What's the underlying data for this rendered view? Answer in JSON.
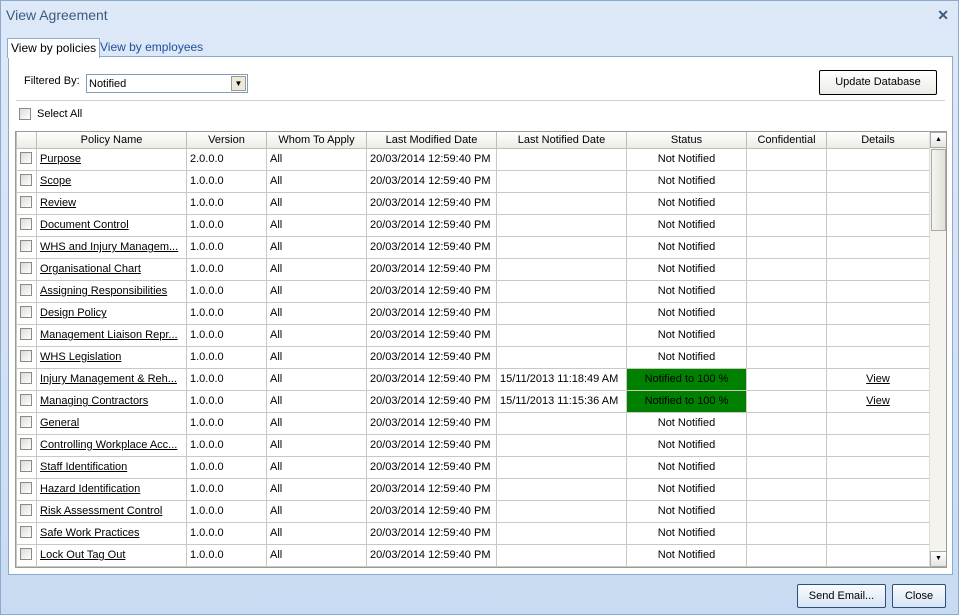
{
  "window": {
    "title": "View Agreement",
    "close_icon": "close-icon"
  },
  "tabs": [
    {
      "label": "View by policies",
      "active": true
    },
    {
      "label": "View by employees",
      "active": false
    }
  ],
  "filter": {
    "label": "Filtered By:",
    "value": "Notified"
  },
  "update_button": "Update Database",
  "select_all": "Select All",
  "columns": [
    "",
    "Policy Name",
    "Version",
    "Whom To Apply",
    "Last Modified Date",
    "Last Notified Date",
    "Status",
    "Confidential",
    "Details"
  ],
  "status_color": "#008000",
  "rows": [
    {
      "name": "Purpose",
      "version": "2.0.0.0",
      "whom": "All",
      "modified": "20/03/2014 12:59:40 PM",
      "notified": "",
      "status": "Not Notified",
      "confidential": "",
      "details": ""
    },
    {
      "name": "Scope",
      "version": "1.0.0.0",
      "whom": "All",
      "modified": "20/03/2014 12:59:40 PM",
      "notified": "",
      "status": "Not Notified",
      "confidential": "",
      "details": ""
    },
    {
      "name": "Review",
      "version": "1.0.0.0",
      "whom": "All",
      "modified": "20/03/2014 12:59:40 PM",
      "notified": "",
      "status": "Not Notified",
      "confidential": "",
      "details": ""
    },
    {
      "name": "Document Control",
      "version": "1.0.0.0",
      "whom": "All",
      "modified": "20/03/2014 12:59:40 PM",
      "notified": "",
      "status": "Not Notified",
      "confidential": "",
      "details": ""
    },
    {
      "name": "WHS and Injury Managem...",
      "version": "1.0.0.0",
      "whom": "All",
      "modified": "20/03/2014 12:59:40 PM",
      "notified": "",
      "status": "Not Notified",
      "confidential": "",
      "details": ""
    },
    {
      "name": "Organisational Chart",
      "version": "1.0.0.0",
      "whom": "All",
      "modified": "20/03/2014 12:59:40 PM",
      "notified": "",
      "status": "Not Notified",
      "confidential": "",
      "details": ""
    },
    {
      "name": "Assigning Responsibilities",
      "version": "1.0.0.0",
      "whom": "All",
      "modified": "20/03/2014 12:59:40 PM",
      "notified": "",
      "status": "Not Notified",
      "confidential": "",
      "details": ""
    },
    {
      "name": "Design Policy",
      "version": "1.0.0.0",
      "whom": "All",
      "modified": "20/03/2014 12:59:40 PM",
      "notified": "",
      "status": "Not Notified",
      "confidential": "",
      "details": ""
    },
    {
      "name": "Management Liaison Repr...",
      "version": "1.0.0.0",
      "whom": "All",
      "modified": "20/03/2014 12:59:40 PM",
      "notified": "",
      "status": "Not Notified",
      "confidential": "",
      "details": ""
    },
    {
      "name": "WHS Legislation",
      "version": "1.0.0.0",
      "whom": "All",
      "modified": "20/03/2014 12:59:40 PM",
      "notified": "",
      "status": "Not Notified",
      "confidential": "",
      "details": ""
    },
    {
      "name": "Injury Management & Reh...",
      "version": "1.0.0.0",
      "whom": "All",
      "modified": "20/03/2014 12:59:40 PM",
      "notified": "15/11/2013 11:18:49 AM",
      "status": "Notified to 100 %",
      "confidential": "",
      "details": "View"
    },
    {
      "name": "Managing Contractors",
      "version": "1.0.0.0",
      "whom": "All",
      "modified": "20/03/2014 12:59:40 PM",
      "notified": "15/11/2013 11:15:36 AM",
      "status": "Notified to 100 %",
      "confidential": "",
      "details": "View"
    },
    {
      "name": "General",
      "version": "1.0.0.0",
      "whom": "All",
      "modified": "20/03/2014 12:59:40 PM",
      "notified": "",
      "status": "Not Notified",
      "confidential": "",
      "details": ""
    },
    {
      "name": "Controlling Workplace Acc...",
      "version": "1.0.0.0",
      "whom": "All",
      "modified": "20/03/2014 12:59:40 PM",
      "notified": "",
      "status": "Not Notified",
      "confidential": "",
      "details": ""
    },
    {
      "name": "Staff Identification",
      "version": "1.0.0.0",
      "whom": "All",
      "modified": "20/03/2014 12:59:40 PM",
      "notified": "",
      "status": "Not Notified",
      "confidential": "",
      "details": ""
    },
    {
      "name": "Hazard Identification",
      "version": "1.0.0.0",
      "whom": "All",
      "modified": "20/03/2014 12:59:40 PM",
      "notified": "",
      "status": "Not Notified",
      "confidential": "",
      "details": ""
    },
    {
      "name": "Risk Assessment Control",
      "version": "1.0.0.0",
      "whom": "All",
      "modified": "20/03/2014 12:59:40 PM",
      "notified": "",
      "status": "Not Notified",
      "confidential": "",
      "details": ""
    },
    {
      "name": "Safe Work Practices",
      "version": "1.0.0.0",
      "whom": "All",
      "modified": "20/03/2014 12:59:40 PM",
      "notified": "",
      "status": "Not Notified",
      "confidential": "",
      "details": ""
    },
    {
      "name": "Lock Out Tag Out",
      "version": "1.0.0.0",
      "whom": "All",
      "modified": "20/03/2014 12:59:40 PM",
      "notified": "",
      "status": "Not Notified",
      "confidential": "",
      "details": ""
    }
  ],
  "footer": {
    "send_email": "Send Email...",
    "close": "Close"
  }
}
